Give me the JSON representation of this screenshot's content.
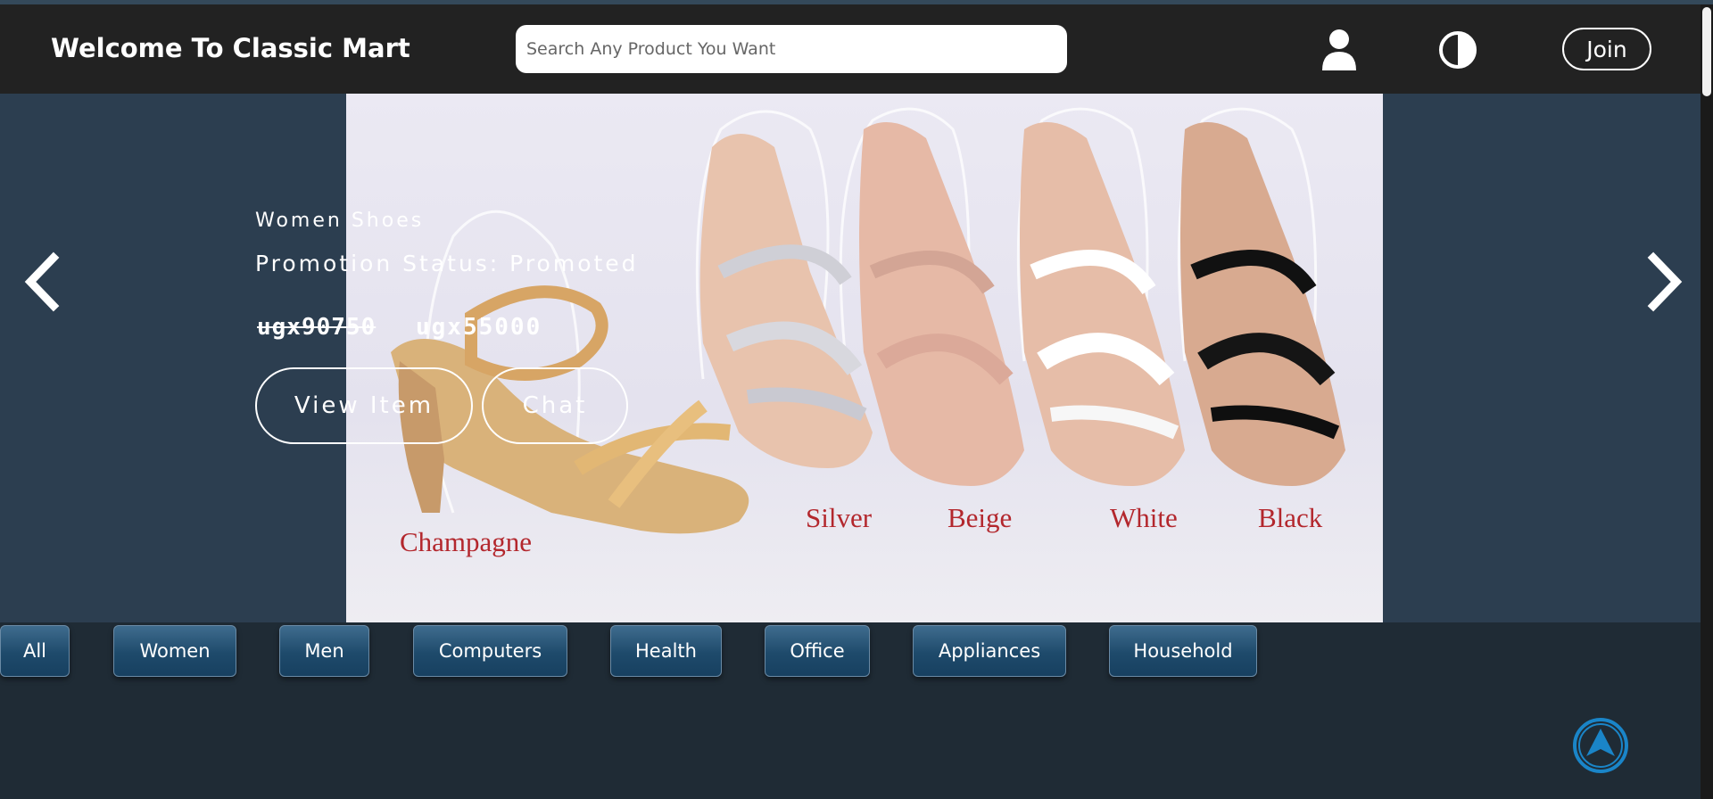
{
  "header": {
    "title": "Welcome To Classic Mart",
    "search_placeholder": "Search Any Product You Want",
    "join_label": "Join",
    "icons": {
      "user": "user-icon",
      "theme": "contrast-icon"
    }
  },
  "carousel": {
    "category": "Women Shoes",
    "promotion_status": "Promotion Status: Promoted",
    "old_price": "ugx90750",
    "new_price": "ugx55000",
    "view_label": "View Item",
    "chat_label": "Chat",
    "image_labels": [
      "Champagne",
      "Silver",
      "Beige",
      "White",
      "Black"
    ],
    "icons": {
      "prev": "chevron-left-icon",
      "next": "chevron-right-icon"
    }
  },
  "categories": [
    "All",
    "Women",
    "Men",
    "Computers",
    "Health",
    "Office",
    "Appliances",
    "Household"
  ],
  "back_to_top_icon": "arrow-up-circle-icon",
  "colors": {
    "header_bg": "#222222",
    "carousel_bg": "#2c3e50",
    "page_bg": "#1f2b35",
    "category_button": "#1e4a6b",
    "label_red": "#b3272d",
    "back_to_top": "#1a85c8"
  }
}
